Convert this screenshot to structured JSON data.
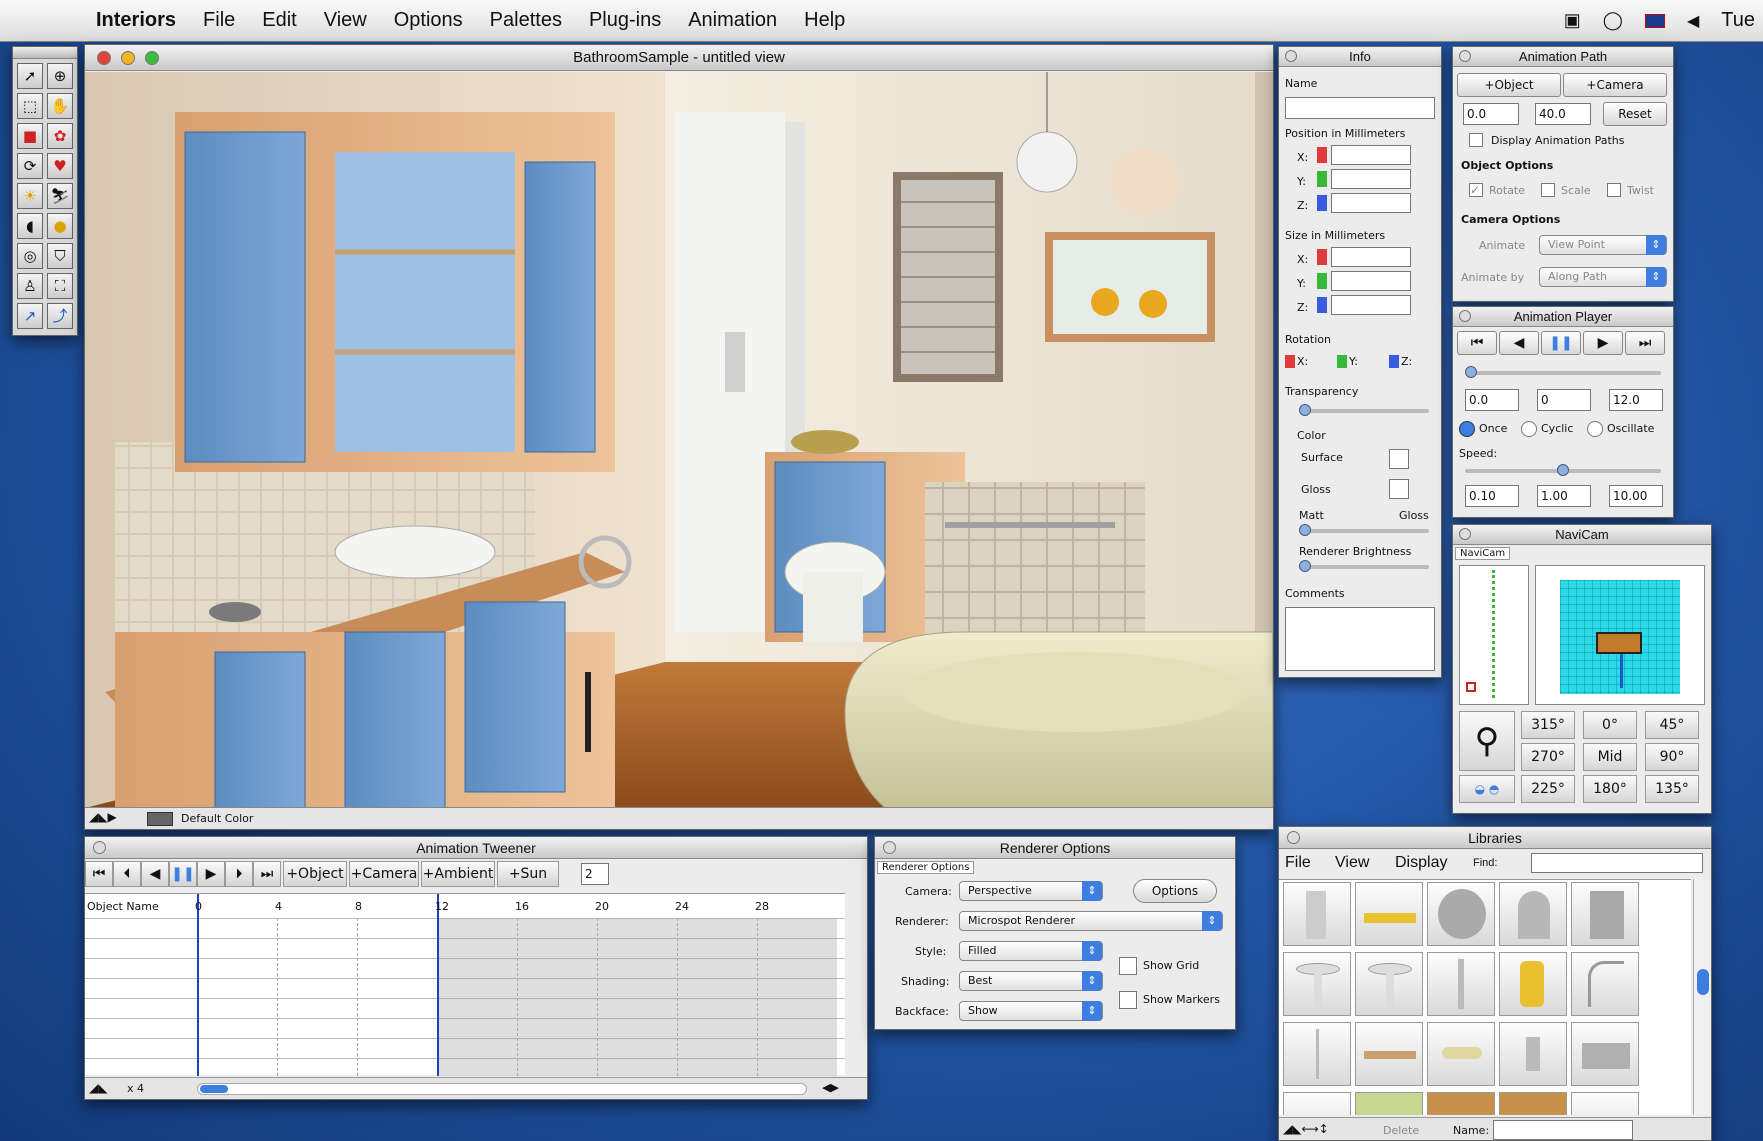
{
  "menubar": {
    "app_name": "Interiors",
    "items": [
      "File",
      "Edit",
      "View",
      "Options",
      "Palettes",
      "Plug-ins",
      "Animation",
      "Help"
    ],
    "clock": "Tue"
  },
  "main_window": {
    "title": "BathroomSample - untitled view",
    "status_label": "Default Color"
  },
  "info": {
    "title": "Info",
    "name_label": "Name",
    "position_label": "Position in Millimeters",
    "size_label": "Size in Millimeters",
    "axes": [
      "X:",
      "Y:",
      "Z:"
    ],
    "rotation_label": "Rotation",
    "rotation_axes": [
      "X:",
      "Y:",
      "Z:"
    ],
    "transparency_label": "Transparency",
    "color_label": "Color",
    "surface_label": "Surface",
    "gloss_label": "Gloss",
    "matt_label": "Matt",
    "gloss_end_label": "Gloss",
    "renderer_brightness_label": "Renderer Brightness",
    "comments_label": "Comments"
  },
  "anim_path": {
    "title": "Animation Path",
    "object_btn": "+Object",
    "camera_btn": "+Camera",
    "start_value": "0.0",
    "end_value": "40.0",
    "reset_btn": "Reset",
    "display_paths_label": "Display Animation Paths",
    "object_options_label": "Object Options",
    "rotate_label": "Rotate",
    "scale_label": "Scale",
    "twist_label": "Twist",
    "camera_options_label": "Camera Options",
    "animate_label": "Animate",
    "animate_value": "View Point",
    "animate_by_label": "Animate by",
    "animate_by_value": "Along Path"
  },
  "anim_player": {
    "title": "Animation Player",
    "start": "0.0",
    "current": "0",
    "end": "12.0",
    "once_label": "Once",
    "cyclic_label": "Cyclic",
    "oscillate_label": "Oscillate",
    "speed_label": "Speed:",
    "speed_min": "0.10",
    "speed_val": "1.00",
    "speed_max": "10.00",
    "playhead_fraction": 0.0,
    "speed_fraction": 0.5
  },
  "navicam": {
    "title": "NaviCam",
    "tab_label": "NaviCam",
    "angles": [
      "315°",
      "0°",
      "45°",
      "270°",
      "Mid",
      "90°",
      "225°",
      "180°",
      "135°"
    ]
  },
  "tweener": {
    "title": "Animation Tweener",
    "buttons": [
      "+Object",
      "+Camera",
      "+Ambient",
      "+Sun"
    ],
    "step_value": "2",
    "object_name_header": "Object Name",
    "ticks": [
      "0",
      "4",
      "8",
      "12",
      "16",
      "20",
      "24",
      "28"
    ],
    "zoom_label": "x 4",
    "current_frame": 12
  },
  "renderer": {
    "title": "Renderer Options",
    "tab_label": "Renderer Options",
    "camera_label": "Camera:",
    "camera_value": "Perspective",
    "options_btn": "Options",
    "renderer_label": "Renderer:",
    "renderer_value": "Microspot Renderer",
    "style_label": "Style:",
    "style_value": "Filled",
    "shading_label": "Shading:",
    "shading_value": "Best",
    "backface_label": "Backface:",
    "backface_value": "Show",
    "show_grid_label": "Show Grid",
    "show_markers_label": "Show Markers"
  },
  "libraries": {
    "title": "Libraries",
    "menus": [
      "File",
      "View",
      "Display"
    ],
    "find_label": "Find:",
    "delete_btn": "Delete",
    "name_label": "Name:"
  },
  "colors": {
    "desktop": "#2458a8",
    "accent": "#3d7ee0",
    "close": "#e0443c",
    "minimize": "#f0b429",
    "zoom": "#3cbc3c"
  }
}
